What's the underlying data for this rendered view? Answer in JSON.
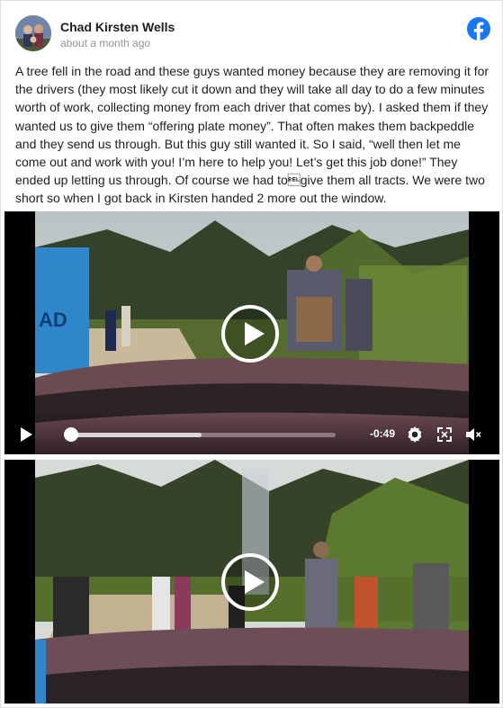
{
  "post": {
    "author": "Chad Kirsten Wells",
    "timestamp": "about a month ago",
    "text": "A tree fell in the road and these guys wanted money because they are removing it for the drivers (they most likely cut it down and they will take all day to do a few minutes worth of work, collecting money from each driver that comes by). I asked them if they wanted us to give them “offering plate money”. That often makes them backpeddle and they send us through. But this guy still wanted it. So I said, “well then let me come out and work with you! I’m here to help you! Let’s get this job done!” They ended up letting us through. Of course we had to\u0007give them all tracts. We were two short so when I got back in Kirsten handed 2 more out the window."
  },
  "video1": {
    "time_remaining": "-0:49",
    "progress_fraction": 0.0,
    "buffered_fraction": 0.5
  },
  "icons": {
    "brand": "facebook-icon",
    "play": "play-icon",
    "settings": "gear-icon",
    "fullscreen": "fullscreen-icon",
    "volume": "volume-muted-icon"
  },
  "colors": {
    "brand_blue": "#1877f2",
    "text": "#1c1e21",
    "meta": "#90949c"
  }
}
